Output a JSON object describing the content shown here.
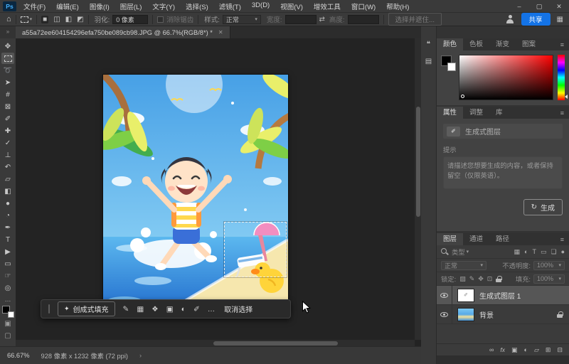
{
  "ui": {
    "caret": "▾",
    "menu_icon": "≡"
  },
  "titlebar": {
    "logo": "Ps",
    "menus": [
      "文件(F)",
      "编辑(E)",
      "图像(I)",
      "图层(L)",
      "文字(Y)",
      "选择(S)",
      "滤镜(T)",
      "3D(D)",
      "视图(V)",
      "增效工具",
      "窗口(W)",
      "帮助(H)"
    ],
    "window_controls": {
      "minimize": "–",
      "maximize": "▢",
      "close": "✕"
    }
  },
  "options_bar": {
    "home_icon": "⌂",
    "selection_modes": {
      "new": "■",
      "add": "◫",
      "subtract": "◧",
      "intersect": "◩"
    },
    "feather_label": "羽化:",
    "feather_value": "0 像素",
    "antialias_label": "消除锯齿",
    "style_label": "样式:",
    "style_value": "正常",
    "width_label": "宽度:",
    "swap_icon": "⇄",
    "height_label": "高度:",
    "select_and_mask_label": "选择并遮住...",
    "share_label": "共享",
    "workspace_icon": "▦"
  },
  "document_tab": {
    "title": "a55a72ee604154296efa750be089cb98.JPG @ 66.7%(RGB/8*) *",
    "close_icon": "✕"
  },
  "toolbar": {
    "collapse_icon": "»",
    "tools": [
      {
        "name": "移动工具",
        "glyph": "✥"
      },
      {
        "name": "矩形选框工具",
        "glyph": ""
      },
      {
        "name": "套索工具",
        "glyph": "➰"
      },
      {
        "name": "对象选择工具",
        "glyph": "➤"
      },
      {
        "name": "裁剪工具",
        "glyph": "#"
      },
      {
        "name": "图框工具",
        "glyph": "⊠"
      },
      {
        "name": "吸管工具",
        "glyph": "✐"
      },
      {
        "name": "污点修复画笔工具",
        "glyph": "✚"
      },
      {
        "name": "画笔工具",
        "glyph": "✓"
      },
      {
        "name": "仿制图章工具",
        "glyph": "⊥"
      },
      {
        "name": "历史记录画笔工具",
        "glyph": "↶"
      },
      {
        "name": "橡皮擦工具",
        "glyph": "▱"
      },
      {
        "name": "渐变工具",
        "glyph": "◧"
      },
      {
        "name": "模糊工具",
        "glyph": "●"
      },
      {
        "name": "减淡工具",
        "glyph": "◔"
      },
      {
        "name": "钢笔工具",
        "glyph": "✒"
      },
      {
        "name": "文字工具",
        "glyph": "T"
      },
      {
        "name": "路径选择工具",
        "glyph": "▶"
      },
      {
        "name": "矩形工具",
        "glyph": "▭"
      },
      {
        "name": "抓手工具",
        "glyph": "☞"
      },
      {
        "name": "缩放工具",
        "glyph": "◎"
      }
    ],
    "more_icon": "…",
    "quick_mask_icon": "▣",
    "screen_mode_icon": "▢"
  },
  "taskbar": {
    "sparkle_icon": "✦",
    "generative_fill_label": "创成式填充",
    "icons": {
      "selection_brush": "✎",
      "adjustments": "▦",
      "transform": "❖",
      "add_mask": "▣",
      "adjustment_layer": "◐",
      "fill": "✐",
      "more": "…"
    },
    "deselect_label": "取消选择"
  },
  "dock_strip": {
    "comments": "❝",
    "panel": "▤"
  },
  "panels": {
    "color": {
      "tabs": [
        "颜色",
        "色板",
        "渐变",
        "图案"
      ]
    },
    "properties": {
      "tabs": [
        "属性",
        "调整",
        "库"
      ],
      "layer_badge_label": "生成式图层",
      "badge_icon": "✐",
      "prompt_label": "提示",
      "prompt_placeholder": "请描述您想要生成的内容，或者保持留空（仅限英语）。",
      "generate_icon": "↻",
      "generate_label": "生成"
    },
    "layers": {
      "tabs": [
        "图层",
        "通道",
        "路径"
      ],
      "filter_label": "类型",
      "filter_icons": {
        "pixel": "▦",
        "adjustment": "◐",
        "type": "T",
        "shape": "▭",
        "smart": "❏",
        "pin": "●"
      },
      "blend_mode": "正常",
      "opacity_label": "不透明度:",
      "opacity_value": "100%",
      "lock_label": "锁定:",
      "lock_icons": {
        "transparent": "▨",
        "pixels": "✎",
        "position": "✥",
        "artboard": "⊡"
      },
      "fill_label": "填充:",
      "fill_value": "100%",
      "rows": [
        {
          "name": "生成式图层 1"
        },
        {
          "name": "背景"
        }
      ],
      "footer_icons": {
        "link": "∞",
        "fx": "fx",
        "mask": "▣",
        "adjustment": "◐",
        "group": "▱",
        "new_layer": "⊞",
        "delete": "⊟"
      }
    }
  },
  "status_bar": {
    "zoom_level": "66.67%",
    "doc_info": "928 像素 x 1232 像素 (72 ppi)",
    "chevron": "›"
  },
  "colors": {
    "accent_blue": "#1473e6"
  }
}
